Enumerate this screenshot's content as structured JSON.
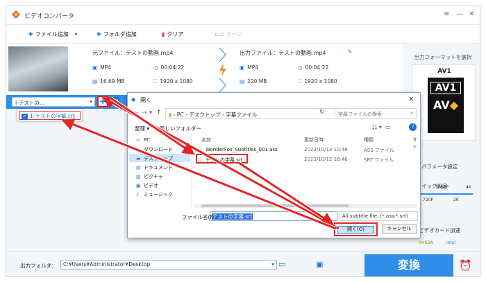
{
  "app": {
    "title": "ビデオコンバータ",
    "window_controls": [
      "≡",
      "—",
      "✕"
    ]
  },
  "toolbar": {
    "add_file": "ファイル追加",
    "add_folder": "フォルダ追加",
    "clear": "クリア",
    "merge": "マージ"
  },
  "source": {
    "label": "元ファイル：テストの動画.mp4",
    "format": "MP4",
    "duration": "00:04:22",
    "size": "16.69 MB",
    "resolution": "1920 x 1080"
  },
  "output": {
    "label": "出力ファイル：テストの動画.mp4",
    "format": "MP4",
    "duration": "00:04:22",
    "size": "220 MB",
    "resolution": "1920 x 1080"
  },
  "subtitle_bar": {
    "selected": "Ⅰ-テストの...",
    "add_symbol": "+",
    "cc": "cc"
  },
  "subtitle_dropdown": {
    "item": "1-テストの字幕.srt"
  },
  "right_panel": {
    "format_label": "出力フォーマットを選択",
    "format_name": "AV1",
    "logo_text": "AV1",
    "param_settings": "パラメータ設定",
    "quick_settings": "イック設定",
    "quality_marks_top": [
      "1080P",
      "4K"
    ],
    "quality_marks_bottom": [
      "720P",
      "2K"
    ],
    "gpu_label": "ビデオカード加速",
    "gpu_brands": [
      "NVIDIA",
      "intel"
    ]
  },
  "bottom": {
    "folder_label": "出力フォルダ：",
    "folder_path": "C:¥Users¥Administrator¥Desktop",
    "convert": "変換"
  },
  "dialog": {
    "title": "開く",
    "path_segments": [
      "PC",
      "デスクトップ",
      "字幕ファイル"
    ],
    "search_placeholder": "字幕ファイルの検索",
    "organize": "整理 ▾",
    "new_folder": "新しいフォルダー",
    "sidebar": [
      "PC",
      "ダウンロード",
      "デスクトップ",
      "ドキュメント",
      "ピクチャ",
      "ビデオ",
      "ミュージック"
    ],
    "columns": [
      "名前",
      "更新日時",
      "種類",
      "サイ"
    ],
    "files": [
      {
        "name": "WonderFox_Subtitles_001.ass",
        "date": "2023/10/13 10:48",
        "type": "ASS ファイル"
      },
      {
        "name": "テストの字幕.srt",
        "date": "2023/10/12 16:48",
        "type": "SRT ファイル"
      }
    ],
    "filename_label": "ファイル名(N):",
    "filename_value": "テストの字幕.srt",
    "filter": "All subtitle file. (*.ass;*.srt)",
    "open_label": "開く(O)",
    "cancel_label": "キャンセル"
  }
}
